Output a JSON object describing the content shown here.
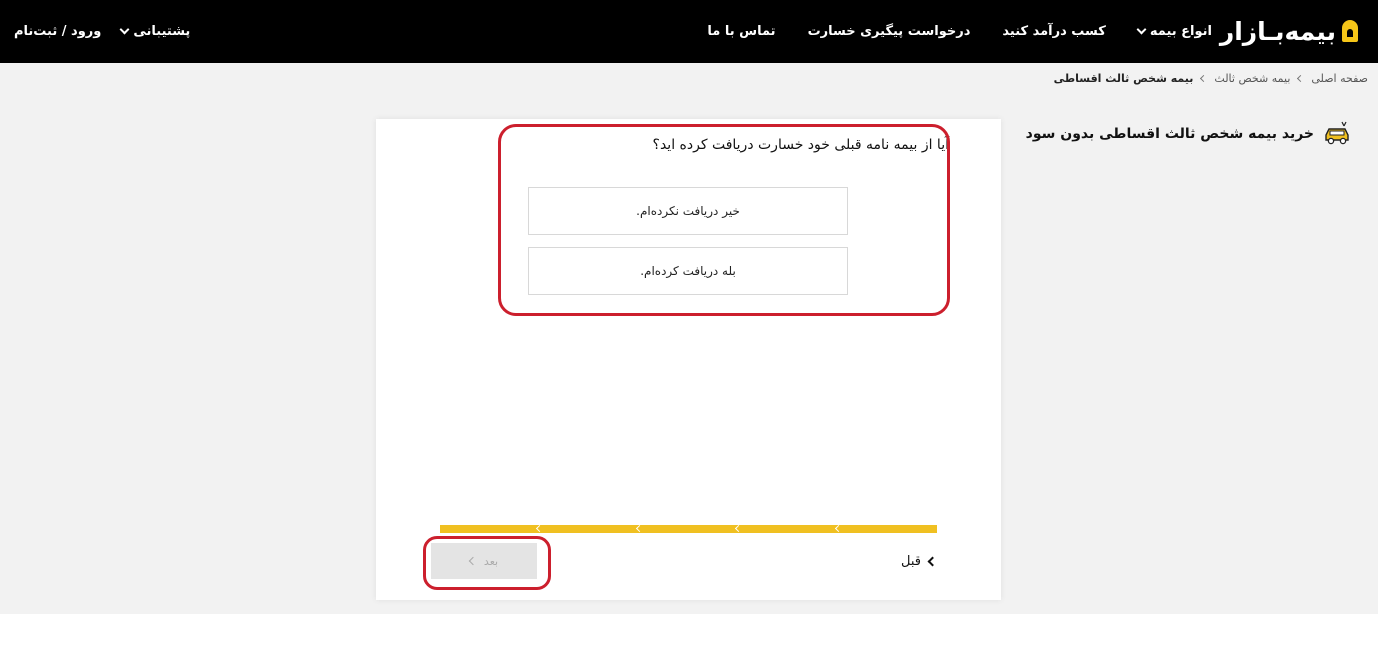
{
  "header": {
    "logo_text": "بیمه‌بـازار",
    "nav": [
      {
        "label": "انواع بیمه"
      },
      {
        "label": "کسب درآمد کنید"
      },
      {
        "label": "درخواست پیگیری خسارت"
      },
      {
        "label": "تماس با ما"
      }
    ],
    "support_label": "پشتیبانی",
    "login_label": "ورود / ثبت‌نام"
  },
  "breadcrumb": {
    "items": [
      "صفحه اصلی",
      "بیمه شخص ثالث",
      "بیمه شخص ثالث اقساطی"
    ]
  },
  "page": {
    "title": "خرید بیمه شخص ثالث اقساطی بدون سود",
    "title_icon": "car-icon"
  },
  "form": {
    "question": "آیا از بیمه نامه قبلی خود خسارت دریافت کرده اید؟",
    "options": [
      {
        "label": "خیر دریافت نکرده‌ام."
      },
      {
        "label": "بله دریافت کرده‌ام."
      }
    ],
    "progress_steps": 5,
    "prev_label": "قبل",
    "next_label": "بعد"
  },
  "colors": {
    "header_bg": "#000000",
    "accent": "#f0c021",
    "highlight": "#cc1f2d"
  }
}
